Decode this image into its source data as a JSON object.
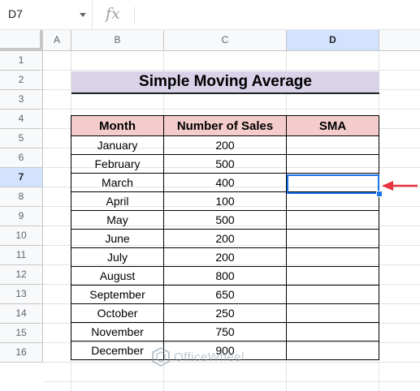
{
  "formula_bar": {
    "cell_ref": "D7",
    "fx_label": "fx",
    "formula": ""
  },
  "columns": [
    "A",
    "B",
    "C",
    "D"
  ],
  "selected_column": "D",
  "rows": [
    "1",
    "2",
    "3",
    "4",
    "5",
    "6",
    "7",
    "8",
    "9",
    "10",
    "11",
    "12",
    "13",
    "14",
    "15",
    "16"
  ],
  "selected_row": "7",
  "title": "Simple Moving Average",
  "table": {
    "headers": [
      "Month",
      "Number of Sales",
      "SMA"
    ],
    "rows": [
      {
        "month": "January",
        "sales": "200",
        "sma": ""
      },
      {
        "month": "February",
        "sales": "500",
        "sma": ""
      },
      {
        "month": "March",
        "sales": "400",
        "sma": ""
      },
      {
        "month": "April",
        "sales": "100",
        "sma": ""
      },
      {
        "month": "May",
        "sales": "500",
        "sma": ""
      },
      {
        "month": "June",
        "sales": "200",
        "sma": ""
      },
      {
        "month": "July",
        "sales": "200",
        "sma": ""
      },
      {
        "month": "August",
        "sales": "800",
        "sma": ""
      },
      {
        "month": "September",
        "sales": "650",
        "sma": ""
      },
      {
        "month": "October",
        "sales": "250",
        "sma": ""
      },
      {
        "month": "November",
        "sales": "750",
        "sma": ""
      },
      {
        "month": "December",
        "sales": "900",
        "sma": ""
      }
    ]
  },
  "colors": {
    "title_bg": "#d9d2e9",
    "header_bg": "#f4cccc",
    "selection": "#1a73e8",
    "arrow": "#e8323c"
  },
  "watermark": "OfficeWheel"
}
